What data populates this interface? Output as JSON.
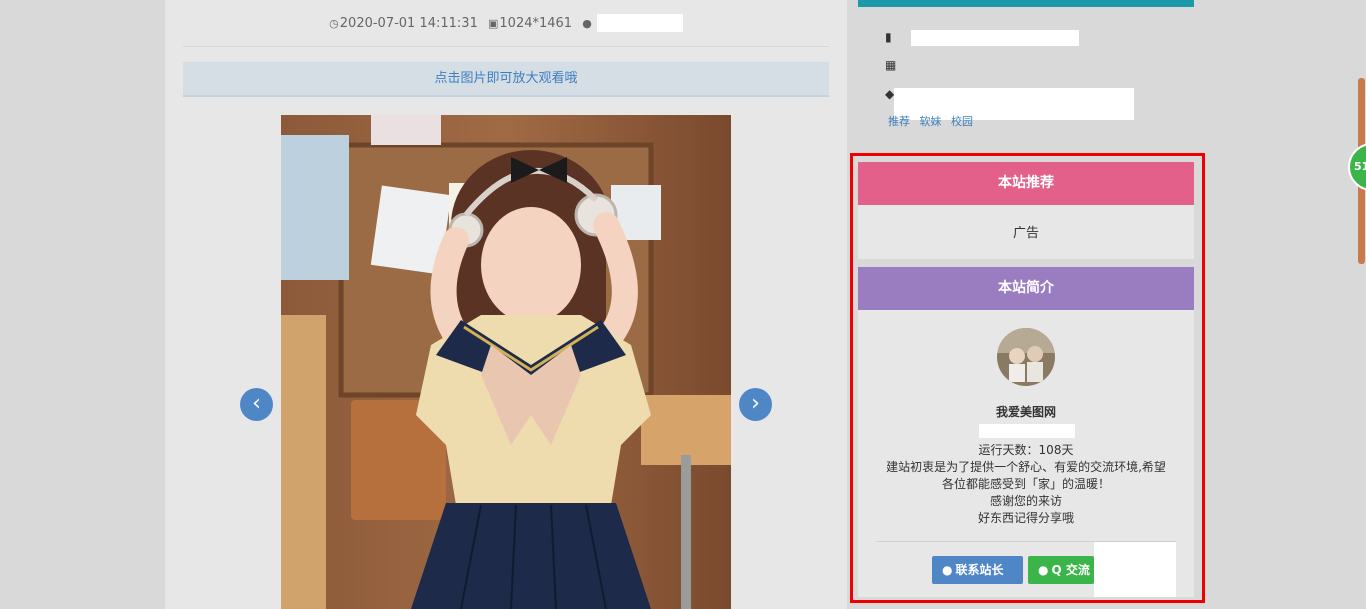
{
  "meta": {
    "datetime": "2020-07-01 14:11:31",
    "resolution": "1024*1461",
    "icons": {
      "clock": "clock-icon",
      "image": "image-icon",
      "user": "user-icon"
    }
  },
  "notice": "点击图片即可放大观看哦",
  "nav": {
    "prev": "‹",
    "next": "›"
  },
  "sidebar": {
    "recommend": {
      "title": "本站推荐",
      "content": "广告",
      "color": "#e2608a"
    },
    "intro": {
      "title": "本站简介",
      "color": "#9a7cc1",
      "site_name": "我爱美图网",
      "run_days": "运行天数：108天",
      "desc1": "建站初衷是为了提供一个舒心、有爱的交流环境,希望",
      "desc2": "各位都能感受到「家」的温暖！",
      "desc3": "感谢您的来访",
      "desc4": "好东西记得分享哦",
      "btn_contact": "联系站长",
      "btn_group": "Q 交流"
    }
  },
  "tags": [
    "推荐",
    "软妹",
    "校园"
  ],
  "badge": "51"
}
